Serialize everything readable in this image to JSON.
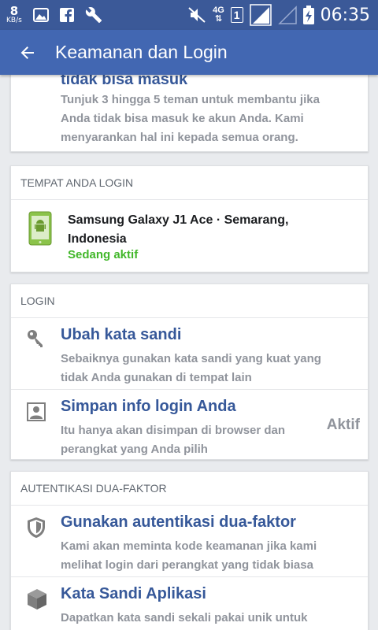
{
  "status_bar": {
    "speed_value": "8",
    "speed_unit": "KB/s",
    "network_type": "4G",
    "sim_slot": "1",
    "time": "06:35",
    "icons": [
      "image-icon",
      "facebook-icon",
      "wrench-icon",
      "mute-icon",
      "signal-icon",
      "signal-empty-icon",
      "battery-charging-icon"
    ]
  },
  "app_bar": {
    "title": "Keamanan dan Login",
    "back_icon": "arrow-left-icon"
  },
  "colors": {
    "brand": "#3b5998",
    "app_bar": "#4267b2",
    "link": "#365899",
    "muted": "#90949c",
    "active_green": "#42b72a"
  },
  "trusted_contacts": {
    "title_partial": "tidak bisa masuk",
    "description": "Tunjuk 3 hingga 5 teman untuk membantu jika Anda tidak bisa masuk ke akun Anda. Kami menyarankan hal ini kepada semua orang."
  },
  "where_logged_in": {
    "header": "TEMPAT ANDA LOGIN",
    "device": "Samsung Galaxy J1 Ace · Semarang, Indonesia",
    "status": "Sedang aktif"
  },
  "login": {
    "header": "LOGIN",
    "items": [
      {
        "title": "Ubah kata sandi",
        "description": "Sebaiknya gunakan kata sandi yang kuat yang tidak Anda gunakan di tempat lain",
        "icon": "key-icon"
      },
      {
        "title": "Simpan info login Anda",
        "description": "Itu hanya akan disimpan di browser dan perangkat yang Anda pilih",
        "status": "Aktif",
        "icon": "profile-icon"
      }
    ]
  },
  "two_factor": {
    "header": "AUTENTIKASI DUA-FAKTOR",
    "items": [
      {
        "title": "Gunakan autentikasi dua-faktor",
        "description": "Kami akan meminta kode keamanan jika kami melihat login dari perangkat yang tidak biasa",
        "icon": "shield-icon"
      },
      {
        "title": "Kata Sandi Aplikasi",
        "description": "Dapatkan kata sandi sekali pakai unik untuk aplikasi yang tidak mendukung autentikasi dua",
        "icon": "cube-icon"
      }
    ]
  }
}
